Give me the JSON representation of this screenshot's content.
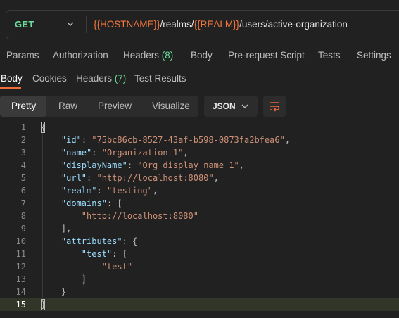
{
  "request": {
    "method": "GET",
    "url_parts": [
      {
        "text": "{{HOSTNAME}}",
        "var": true
      },
      {
        "text": "/realms/",
        "var": false
      },
      {
        "text": "{{REALM}}",
        "var": true
      },
      {
        "text": "/users/active-organization",
        "var": false
      }
    ]
  },
  "request_tabs": [
    "Params",
    "Authorization",
    "Headers",
    "(8)",
    "Body",
    "Pre-request Script",
    "Tests",
    "Settings"
  ],
  "response_tabs": {
    "body": "Body",
    "cookies": "Cookies",
    "headers": "Headers",
    "headers_count": "(7)",
    "test_results": "Test Results"
  },
  "view_modes": [
    "Pretty",
    "Raw",
    "Preview",
    "Visualize"
  ],
  "format": "JSON",
  "code_lines": [
    {
      "n": "1",
      "tokens": [
        {
          "t": "{",
          "c": "p"
        }
      ]
    },
    {
      "n": "2",
      "tokens": [
        {
          "t": "    ",
          "c": "p"
        },
        {
          "t": "\"id\"",
          "c": "k"
        },
        {
          "t": ": ",
          "c": "p"
        },
        {
          "t": "\"75bc86cb-8527-43af-b598-0873fa2bfea6\"",
          "c": "s"
        },
        {
          "t": ",",
          "c": "p"
        }
      ]
    },
    {
      "n": "3",
      "tokens": [
        {
          "t": "    ",
          "c": "p"
        },
        {
          "t": "\"name\"",
          "c": "k"
        },
        {
          "t": ": ",
          "c": "p"
        },
        {
          "t": "\"Organization 1\"",
          "c": "s"
        },
        {
          "t": ",",
          "c": "p"
        }
      ]
    },
    {
      "n": "4",
      "tokens": [
        {
          "t": "    ",
          "c": "p"
        },
        {
          "t": "\"displayName\"",
          "c": "k"
        },
        {
          "t": ": ",
          "c": "p"
        },
        {
          "t": "\"Org display name 1\"",
          "c": "s"
        },
        {
          "t": ",",
          "c": "p"
        }
      ]
    },
    {
      "n": "5",
      "tokens": [
        {
          "t": "    ",
          "c": "p"
        },
        {
          "t": "\"url\"",
          "c": "k"
        },
        {
          "t": ": ",
          "c": "p"
        },
        {
          "t": "\"",
          "c": "s"
        },
        {
          "t": "http://localhost:8080",
          "c": "u"
        },
        {
          "t": "\"",
          "c": "s"
        },
        {
          "t": ",",
          "c": "p"
        }
      ]
    },
    {
      "n": "6",
      "tokens": [
        {
          "t": "    ",
          "c": "p"
        },
        {
          "t": "\"realm\"",
          "c": "k"
        },
        {
          "t": ": ",
          "c": "p"
        },
        {
          "t": "\"testing\"",
          "c": "s"
        },
        {
          "t": ",",
          "c": "p"
        }
      ]
    },
    {
      "n": "7",
      "tokens": [
        {
          "t": "    ",
          "c": "p"
        },
        {
          "t": "\"domains\"",
          "c": "k"
        },
        {
          "t": ": [",
          "c": "p"
        }
      ]
    },
    {
      "n": "8",
      "tokens": [
        {
          "t": "        ",
          "c": "p"
        },
        {
          "t": "\"",
          "c": "s"
        },
        {
          "t": "http://localhost:8080",
          "c": "u"
        },
        {
          "t": "\"",
          "c": "s"
        }
      ]
    },
    {
      "n": "9",
      "tokens": [
        {
          "t": "    ],",
          "c": "p"
        }
      ]
    },
    {
      "n": "10",
      "tokens": [
        {
          "t": "    ",
          "c": "p"
        },
        {
          "t": "\"attributes\"",
          "c": "k"
        },
        {
          "t": ": {",
          "c": "p"
        }
      ]
    },
    {
      "n": "11",
      "tokens": [
        {
          "t": "        ",
          "c": "p"
        },
        {
          "t": "\"test\"",
          "c": "k"
        },
        {
          "t": ": [",
          "c": "p"
        }
      ]
    },
    {
      "n": "12",
      "tokens": [
        {
          "t": "            ",
          "c": "p"
        },
        {
          "t": "\"test\"",
          "c": "s"
        }
      ]
    },
    {
      "n": "13",
      "tokens": [
        {
          "t": "        ]",
          "c": "p"
        }
      ]
    },
    {
      "n": "14",
      "tokens": [
        {
          "t": "    }",
          "c": "p"
        }
      ]
    },
    {
      "n": "15",
      "tokens": [
        {
          "t": "}",
          "c": "p"
        }
      ]
    }
  ],
  "colors": {
    "method_get": "#6bdd9a",
    "variable": "#f5763d",
    "active_tab_underline": "#f26b3a",
    "json_key": "#9cdcfe",
    "json_string": "#ce9178"
  },
  "icons": {
    "method_dropdown": "chevron-down-icon",
    "format_dropdown": "chevron-down-icon",
    "wrap": "wrap-lines-icon"
  }
}
